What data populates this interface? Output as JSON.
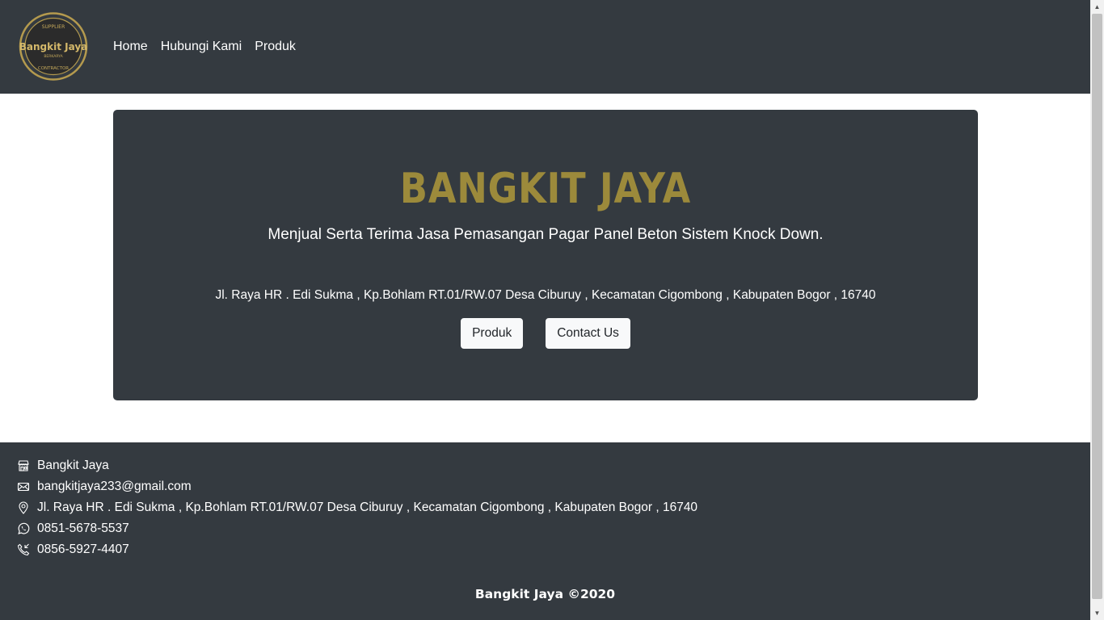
{
  "navbar": {
    "logo": {
      "top_text": "SUPPLIER",
      "main_text": "Bangkit Jaya",
      "sub_text": "BERKARYA",
      "bottom_text": "CONTRACTOR",
      "icon": "brand-logo-icon"
    },
    "links": [
      "Home",
      "Hubungi Kami",
      "Produk"
    ]
  },
  "hero": {
    "title": "BANGKIT JAYA",
    "subtitle": "Menjual Serta Terima Jasa Pemasangan Pagar Panel Beton Sistem Knock Down.",
    "address": "Jl. Raya HR . Edi Sukma , Kp.Bohlam RT.01/RW.07 Desa Ciburuy , Kecamatan Cigombong , Kabupaten Bogor , 16740",
    "buttons": {
      "produk": "Produk",
      "contact": "Contact Us"
    }
  },
  "footer": {
    "items": [
      {
        "icon": "building-icon",
        "text": "Bangkit Jaya"
      },
      {
        "icon": "envelope-icon",
        "text": "bangkitjaya233@gmail.com"
      },
      {
        "icon": "map-pin-icon",
        "text": "Jl. Raya HR . Edi Sukma , Kp.Bohlam RT.01/RW.07 Desa Ciburuy , Kecamatan Cigombong , Kabupaten Bogor , 16740"
      },
      {
        "icon": "whatsapp-icon",
        "text": "0851-5678-5537"
      },
      {
        "icon": "phone-icon",
        "text": "0856-5927-4407"
      }
    ],
    "copyright": "Bangkit Jaya ©2020"
  },
  "colors": {
    "dark_bg": "#343a40",
    "gold": "#9c8a3b",
    "light_btn": "#f8f9fa"
  }
}
